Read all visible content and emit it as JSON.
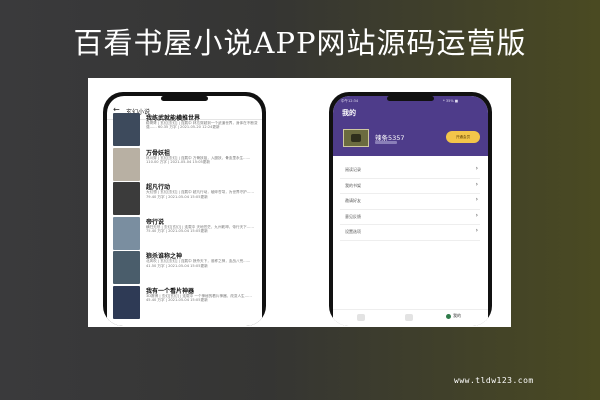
{
  "banner": {
    "title": "百看书屋小说APP网站源码运营版"
  },
  "left_phone": {
    "back_icon": "back-arrow-icon",
    "header_title": "玄幻小说",
    "books": [
      {
        "title": "我练武就能横推世界",
        "meta": "稳哥哥 | 玄幻[玄幻] | 连载中 林忘穿越到一个武道世界，身体在不断变强…… 60.35 万字 | 2021-05-20 12:24更新",
        "cover_color": "#3d4a5c"
      },
      {
        "title": "万骨妖祖",
        "meta": "林川穿 | 玄幻[玄幻] | 连载中 万骨妖祖，入魔妖，骨血里永生…… 110.00 万字 | 2021-05-04 15:05更新",
        "cover_color": "#b8b0a3"
      },
      {
        "title": "超凡行动",
        "meta": "大幻想 | 玄幻[玄幻] | 连载中 超凡行动，破碎苍穹，为世界守护…… 79.40 万字 | 2021-05-04 15:05更新",
        "cover_color": "#3b3b3b"
      },
      {
        "title": "帝行说",
        "meta": "横扫无尽 | 玄幻[玄幻] | 连载中 天地苍茫，九州乾坤，帝行天下…… 75.40 万字 | 2021-05-04 15:05更新",
        "cover_color": "#7a8ea0"
      },
      {
        "title": "狼杀谁称之神",
        "meta": "北风吹 | 玄幻[玄幻] | 连载中 狼杀天下，谁称之神，血战八荒…… 41.50 万字 | 2021-05-04 15:05更新",
        "cover_color": "#4a5d6b"
      },
      {
        "title": "我有一个看片神器",
        "meta": "3D赛博 | 玄幻[玄幻] | 连载中 一个神秘的看片神器，改变人生…… 45.40 万字 | 2021-05-04 15:05更新",
        "cover_color": "#2e3a55"
      }
    ]
  },
  "right_phone": {
    "status_time": "中午12:34",
    "status_icons": "* 35% ■",
    "title": "我的",
    "username": "辣条5357",
    "vip_label": "开通会员",
    "menu": [
      {
        "label": "阅读记录",
        "icon": "chevron-right-icon"
      },
      {
        "label": "我的书架",
        "icon": "chevron-right-icon"
      },
      {
        "label": "邀请好友",
        "icon": "chevron-right-icon"
      },
      {
        "label": "意见反馈",
        "icon": "chevron-right-icon"
      },
      {
        "label": "设置选项",
        "icon": "chevron-right-icon"
      }
    ],
    "tabs": {
      "active_label": "我的"
    }
  },
  "watermark": {
    "text": "www.tldw123.com"
  }
}
